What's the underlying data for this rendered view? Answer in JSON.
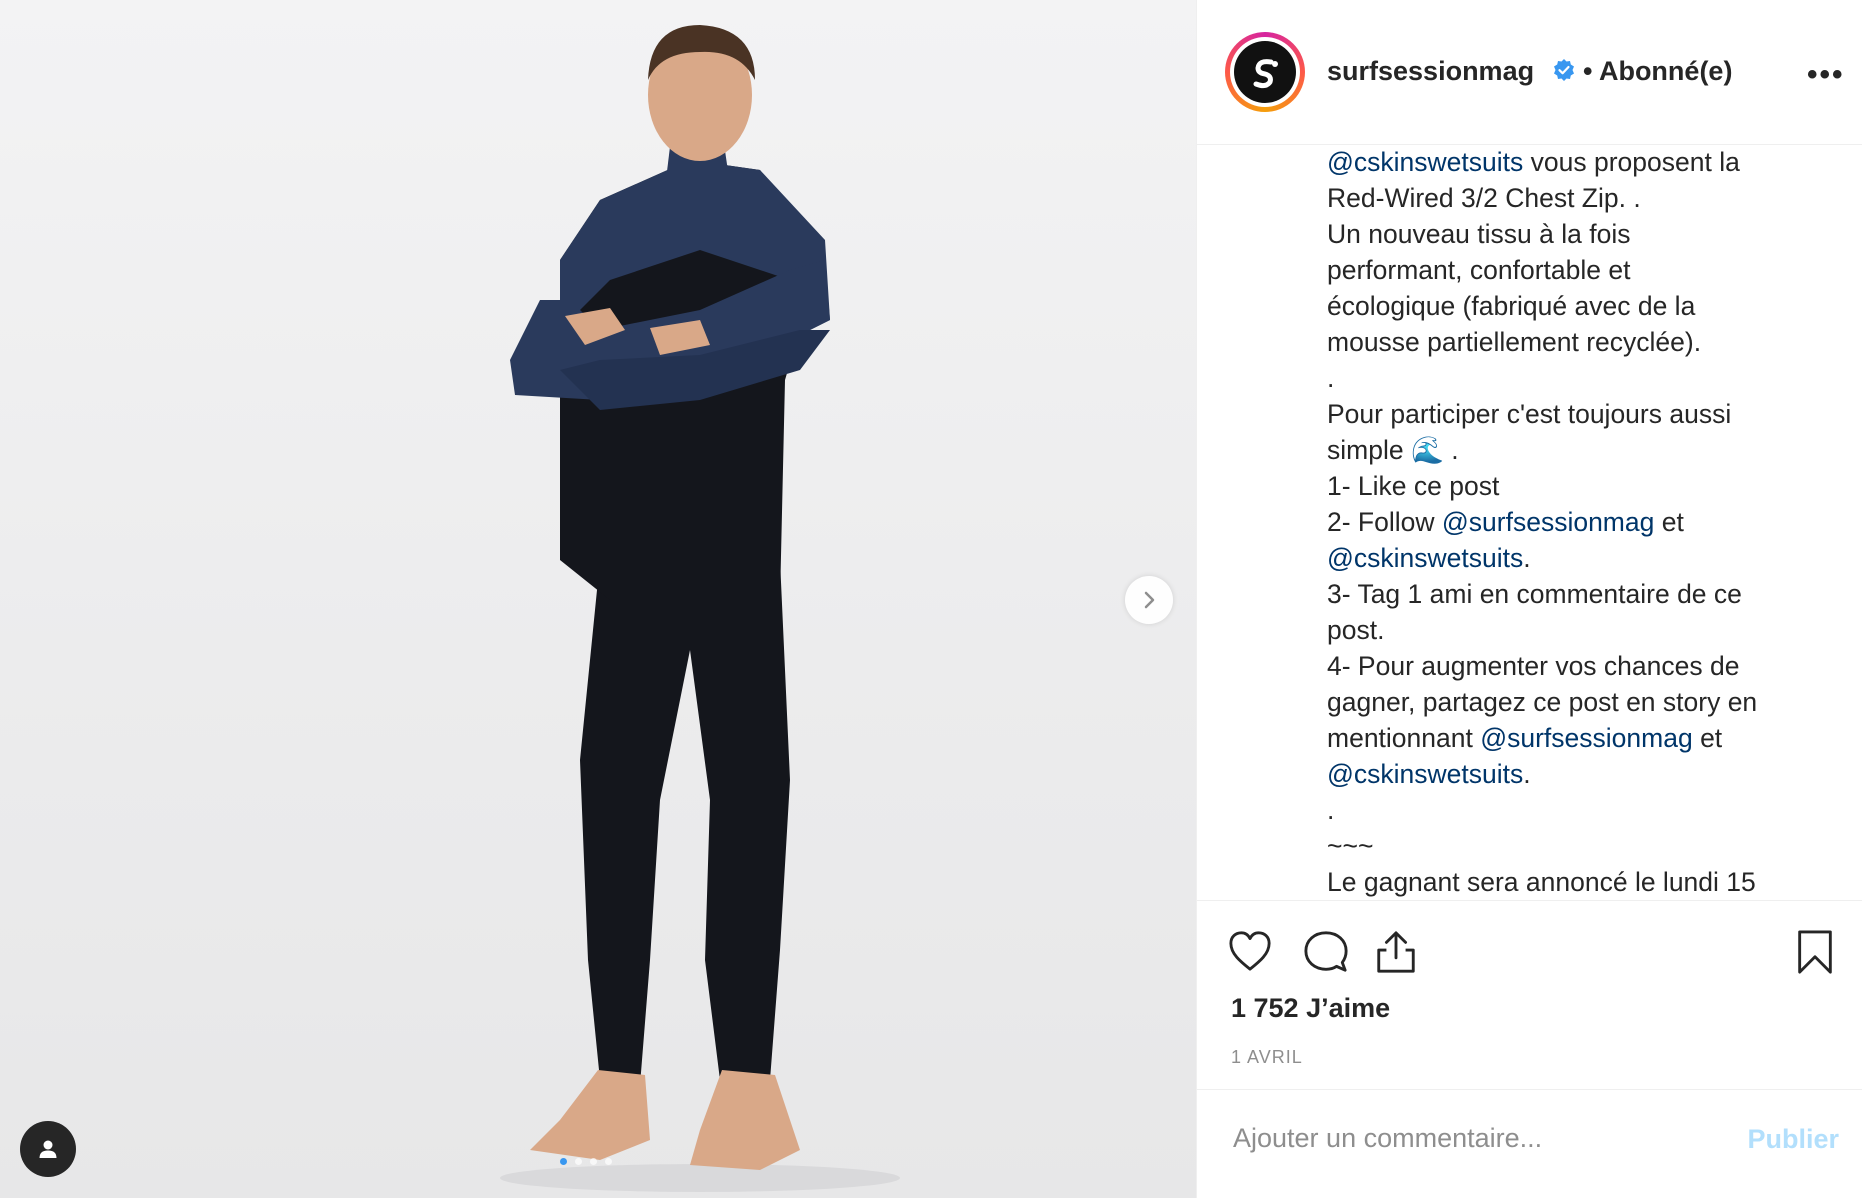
{
  "post": {
    "username": "surfsessionmag",
    "follow_status": "• Abonné(e)",
    "more_label": "•••",
    "caption_lines": [
      [
        {
          "t": "@cskinswetsuits",
          "m": true
        },
        {
          "t": " vous proposent la"
        }
      ],
      [
        {
          "t": "Red-Wired 3/2 Chest Zip. ."
        }
      ],
      [
        {
          "t": "Un nouveau tissu à la fois"
        }
      ],
      [
        {
          "t": "performant, confortable et"
        }
      ],
      [
        {
          "t": "écologique (fabriqué avec de la"
        }
      ],
      [
        {
          "t": "mousse partiellement recyclée)."
        }
      ],
      [
        {
          "t": "."
        }
      ],
      [
        {
          "t": "Pour participer c'est toujours aussi"
        }
      ],
      [
        {
          "t": "simple 🌊 ."
        }
      ],
      [
        {
          "t": "1- Like ce post"
        }
      ],
      [
        {
          "t": "2- Follow "
        },
        {
          "t": "@surfsessionmag",
          "m": true
        },
        {
          "t": " et"
        }
      ],
      [
        {
          "t": "@cskinswetsuits",
          "m": true
        },
        {
          "t": "."
        }
      ],
      [
        {
          "t": "3- Tag 1 ami en commentaire de ce"
        }
      ],
      [
        {
          "t": "post."
        }
      ],
      [
        {
          "t": "4- Pour augmenter vos chances de"
        }
      ],
      [
        {
          "t": "gagner, partagez ce post en story en"
        }
      ],
      [
        {
          "t": "mentionnant "
        },
        {
          "t": "@surfsessionmag",
          "m": true
        },
        {
          "t": " et"
        }
      ],
      [
        {
          "t": "@cskinswetsuits",
          "m": true
        },
        {
          "t": "."
        }
      ],
      [
        {
          "t": "."
        }
      ],
      [
        {
          "t": "~~~"
        }
      ],
      [
        {
          "t": "Le gagnant sera annoncé le lundi 15"
        }
      ]
    ],
    "likes_label": "1 752 J’aime",
    "date_label": "1 AVRIL",
    "comment_placeholder": "Ajouter un commentaire...",
    "publish_label": "Publier"
  },
  "carousel": {
    "slide_count": 4,
    "active_index": 0
  },
  "icons": {
    "avatar": "surfsession-logo-icon",
    "verified": "verified-badge-icon",
    "next": "chevron-right-icon",
    "tag": "user-tag-icon",
    "like": "heart-icon",
    "comment": "comment-bubble-icon",
    "share": "share-icon",
    "save": "bookmark-icon"
  },
  "colors": {
    "mention": "#003569",
    "verified": "#3897f0",
    "publish_disabled": "#b2dffc",
    "wetsuit_navy": "#2a3a5c",
    "wetsuit_black": "#14161c"
  }
}
